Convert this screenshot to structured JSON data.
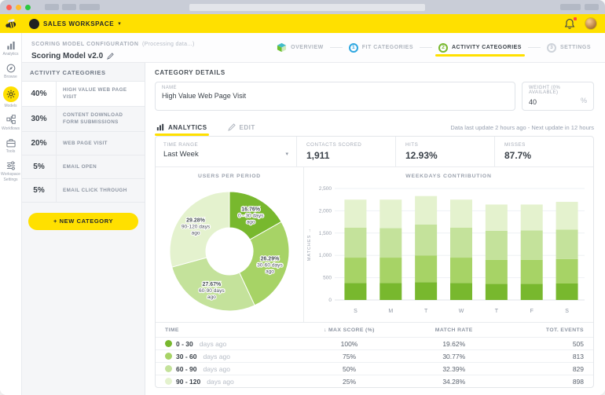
{
  "colors": {
    "brand_yellow": "#ffe000",
    "green_dark": "#78b82e",
    "green_mid": "#a7d366",
    "green_light": "#c4e29b",
    "green_pale": "#e4f2ce",
    "step_blue": "#2ea7e0",
    "notification_red": "#ff4a3d"
  },
  "topbar": {
    "workspace_label": "SALES WORKSPACE",
    "caret": "▾"
  },
  "sidebar": {
    "items": [
      {
        "label": "Analytics",
        "icon": "bar-chart-icon",
        "active": false
      },
      {
        "label": "Browse",
        "icon": "compass-icon",
        "active": false
      },
      {
        "label": "Models",
        "icon": "gear-icon",
        "active": true
      },
      {
        "label": "Workflows",
        "icon": "workflow-icon",
        "active": false
      },
      {
        "label": "Tools",
        "icon": "briefcase-icon",
        "active": false
      },
      {
        "label": "Workspace Settings",
        "icon": "sliders-icon",
        "active": false
      }
    ]
  },
  "header": {
    "eyebrow": "SCORING MODEL CONFIGURATION",
    "processing": "(Processing data...)",
    "title": "Scoring Model v2.0"
  },
  "steps": [
    {
      "label": "OVERVIEW",
      "active": false
    },
    {
      "num": "1",
      "label": "FIT CATEGORIES",
      "active": false
    },
    {
      "num": "2",
      "label": "ACTIVITY CATEGORIES",
      "active": true
    },
    {
      "num": "3",
      "label": "SETTINGS",
      "active": false
    }
  ],
  "categories": {
    "title": "ACTIVITY CATEGORIES",
    "items": [
      {
        "weight": "40%",
        "label": "HIGH VALUE WEB PAGE VISIT",
        "selected": true
      },
      {
        "weight": "30%",
        "label": "CONTENT DOWNLOAD FORM SUBMISSIONS",
        "selected": false
      },
      {
        "weight": "20%",
        "label": "WEB PAGE VISIT",
        "selected": false
      },
      {
        "weight": "5%",
        "label": "EMAIL OPEN",
        "selected": false
      },
      {
        "weight": "5%",
        "label": "EMAIL CLICK THROUGH",
        "selected": false
      }
    ],
    "new_button": "+  NEW CATEGORY"
  },
  "details": {
    "title": "CATEGORY DETAILS",
    "name_label": "NAME",
    "name_value": "High Value Web Page Visit",
    "weight_label": "WEIGHT (0% AVAILABLE)",
    "weight_value": "40",
    "weight_unit": "%"
  },
  "tabs": {
    "analytics": "ANALYTICS",
    "edit": "EDIT",
    "update_note": "Data last update 2 hours ago - Next update in 12 hours"
  },
  "stats": {
    "time_range_label": "TIME RANGE",
    "time_range_value": "Last Week",
    "caret": "▾",
    "items": [
      {
        "label": "CONTACTS SCORED",
        "value": "1,911"
      },
      {
        "label": "HITS",
        "value": "12.93%"
      },
      {
        "label": "MISSES",
        "value": "87.7%"
      }
    ]
  },
  "chart_data": [
    {
      "type": "pie",
      "donut": true,
      "title": "USERS PER PERIOD",
      "labels": [
        "0 - 30 days ago",
        "30-60 days ago",
        "60-90 days ago",
        "90-120 days ago"
      ],
      "values": [
        16.76,
        26.29,
        27.67,
        29.28
      ],
      "colors": [
        "#78b82e",
        "#a7d366",
        "#c4e29b",
        "#e4f2ce"
      ],
      "legend_position": "inside"
    },
    {
      "type": "bar",
      "stacked": true,
      "title": "WEEKDAYS CONTRIBUTION",
      "categories": [
        "S",
        "M",
        "T",
        "W",
        "T",
        "F",
        "S"
      ],
      "ylabel": "MATCHES →",
      "ylim": [
        0,
        2500
      ],
      "yticks": [
        0,
        500,
        1000,
        1500,
        2000,
        2500
      ],
      "grid": true,
      "series": [
        {
          "name": "0 - 30 days ago",
          "color": "#78b82e",
          "values": [
            380,
            380,
            400,
            380,
            360,
            360,
            370
          ]
        },
        {
          "name": "30 - 60 days ago",
          "color": "#a7d366",
          "values": [
            570,
            570,
            600,
            570,
            540,
            540,
            550
          ]
        },
        {
          "name": "60 - 90 days ago",
          "color": "#c4e29b",
          "values": [
            670,
            660,
            690,
            670,
            650,
            660,
            660
          ]
        },
        {
          "name": "90 - 120 days ago",
          "color": "#e4f2ce",
          "values": [
            630,
            640,
            640,
            630,
            590,
            580,
            620
          ]
        }
      ]
    }
  ],
  "table": {
    "sort_arrow": "↓",
    "headers": [
      "TIME",
      "MAX SCORE (%)",
      "MATCH RATE",
      "TOT. EVENTS"
    ],
    "rows": [
      {
        "dot": "#78b82e",
        "range": "0 - 30",
        "suffix": "days ago",
        "max": "100%",
        "match": "19.62%",
        "events": "505"
      },
      {
        "dot": "#a7d366",
        "range": "30 - 60",
        "suffix": "days ago",
        "max": "75%",
        "match": "30.77%",
        "events": "813"
      },
      {
        "dot": "#c4e29b",
        "range": "60 - 90",
        "suffix": "days ago",
        "max": "50%",
        "match": "32.39%",
        "events": "829"
      },
      {
        "dot": "#e4f2ce",
        "range": "90 - 120",
        "suffix": "days ago",
        "max": "25%",
        "match": "34.28%",
        "events": "898"
      }
    ]
  }
}
